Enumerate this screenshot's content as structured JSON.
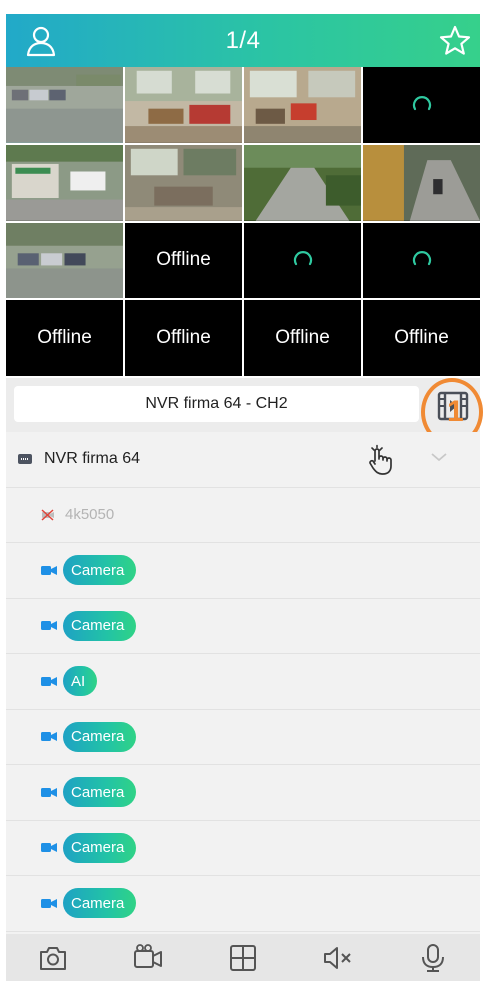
{
  "header": {
    "page_indicator": "1/4",
    "left_icon": "user-icon",
    "right_icon": "star-icon"
  },
  "grid": {
    "tiles": [
      {
        "state": "video",
        "scene": "parking-lot"
      },
      {
        "state": "video",
        "scene": "interior-room"
      },
      {
        "state": "video",
        "scene": "interior-office"
      },
      {
        "state": "loading"
      },
      {
        "state": "video",
        "scene": "street-signs"
      },
      {
        "state": "video",
        "scene": "interior-room-2"
      },
      {
        "state": "video",
        "scene": "garden-path"
      },
      {
        "state": "video",
        "scene": "walkway"
      },
      {
        "state": "video",
        "scene": "parking-lot-2"
      },
      {
        "state": "offline",
        "label": "Offline"
      },
      {
        "state": "loading"
      },
      {
        "state": "loading"
      },
      {
        "state": "offline",
        "label": "Offline"
      },
      {
        "state": "offline",
        "label": "Offline"
      },
      {
        "state": "offline",
        "label": "Offline"
      },
      {
        "state": "offline",
        "label": "Offline"
      }
    ]
  },
  "channel_bar": {
    "current_channel": "NVR firma 64 - CH2",
    "playback_icon": "playback-icon",
    "annotation_number": "1",
    "annotation_color": "#f08a34"
  },
  "device_list": {
    "device": {
      "label": "NVR firma 64",
      "hand_icon": "tap-hand-icon",
      "chevron_icon": "chevron-down-icon"
    },
    "channels": [
      {
        "label": "4k5050",
        "online": false
      },
      {
        "label": "Camera",
        "online": true
      },
      {
        "label": "Camera",
        "online": true
      },
      {
        "label": "AI",
        "online": true
      },
      {
        "label": "Camera",
        "online": true
      },
      {
        "label": "Camera",
        "online": true
      },
      {
        "label": "Camera",
        "online": true
      },
      {
        "label": "Camera",
        "online": true
      }
    ]
  },
  "toolbar": {
    "buttons": [
      "snapshot-icon",
      "record-icon",
      "grid-layout-icon",
      "mute-icon",
      "microphone-icon"
    ]
  },
  "colors": {
    "header_gradient_start": "#22a9c9",
    "header_gradient_end": "#36d08b",
    "camera_icon": "#1e90e6"
  }
}
